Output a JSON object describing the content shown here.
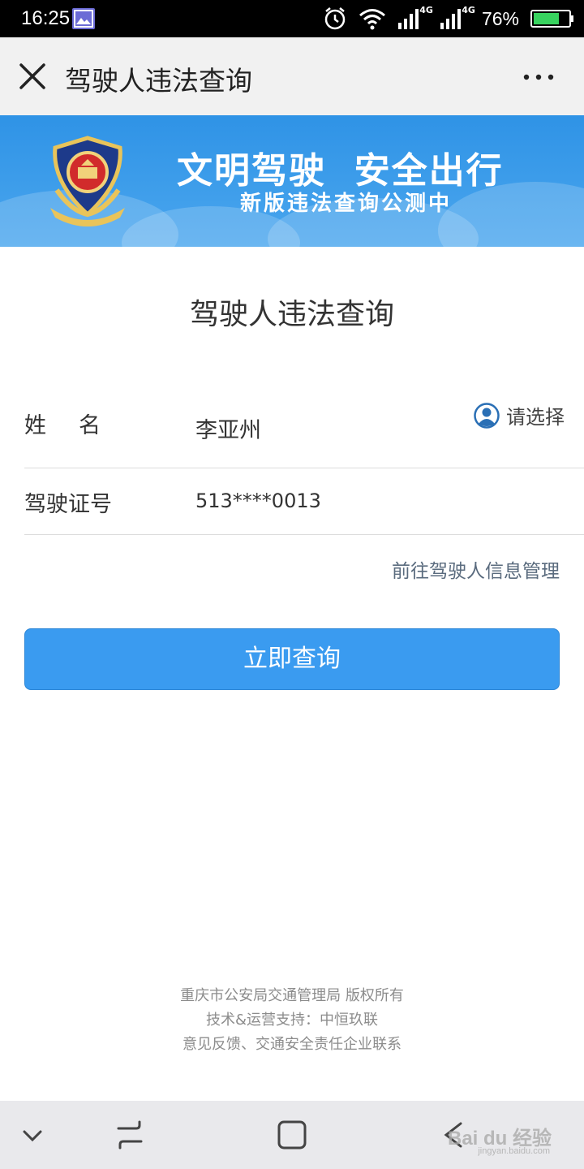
{
  "status_bar": {
    "time": "16:25",
    "battery_percent": "76%",
    "battery_level": 0.76,
    "network_labels": [
      "4G",
      "4G"
    ]
  },
  "title_bar": {
    "title": "驾驶人违法查询"
  },
  "banner": {
    "slogan": "文明驾驶  安全出行",
    "subtitle": "新版违法查询公测中"
  },
  "form": {
    "title": "驾驶人违法查询",
    "name_label": "姓名",
    "name_value": "李亚州",
    "select_label": "请选择",
    "license_label": "驾驶证号",
    "license_value": "513****0013",
    "manage_link": "前往驾驶人信息管理",
    "query_button": "立即查询"
  },
  "footer": {
    "copyright": "重庆市公安局交通管理局 版权所有",
    "support": "技术&运营支持：中恒玖联",
    "feedback": "意见反馈、交通安全责任企业联系"
  },
  "watermark": {
    "brand": "Bai du 经验",
    "url": "jingyan.baidu.com"
  },
  "colors": {
    "accent": "#3a9bf0",
    "banner": "#2f93e6",
    "link": "#5a6b7e"
  }
}
